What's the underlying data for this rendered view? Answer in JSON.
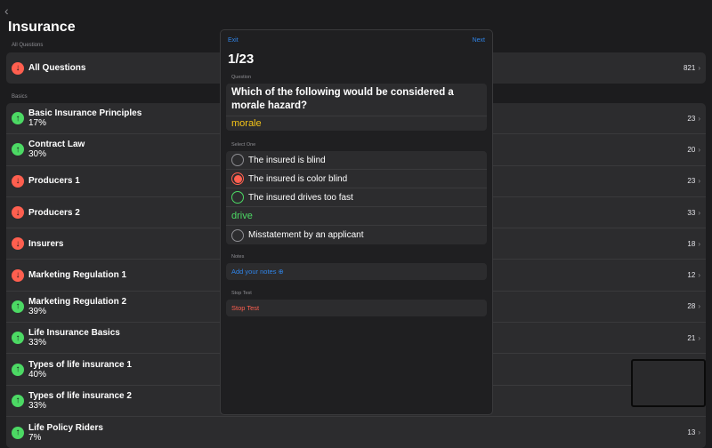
{
  "header": {
    "back_icon": "chevron-left-icon",
    "title": "Insurance"
  },
  "all_section": {
    "label": "All Questions",
    "item": {
      "name": "All Questions",
      "count": "821",
      "trend": "down"
    }
  },
  "basics": {
    "label": "Basics",
    "items": [
      {
        "name": "Basic Insurance Principles",
        "pct": "17%",
        "count": "23",
        "trend": "up"
      },
      {
        "name": "Contract Law",
        "pct": "30%",
        "count": "20",
        "trend": "up"
      },
      {
        "name": "Producers 1",
        "pct": "",
        "count": "23",
        "trend": "down"
      },
      {
        "name": "Producers 2",
        "pct": "",
        "count": "33",
        "trend": "down"
      },
      {
        "name": "Insurers",
        "pct": "",
        "count": "18",
        "trend": "down"
      },
      {
        "name": "Marketing Regulation 1",
        "pct": "",
        "count": "12",
        "trend": "down"
      },
      {
        "name": "Marketing Regulation 2",
        "pct": "39%",
        "count": "28",
        "trend": "up"
      },
      {
        "name": "Life Insurance Basics",
        "pct": "33%",
        "count": "21",
        "trend": "up"
      },
      {
        "name": "Types of life insurance 1",
        "pct": "40%",
        "count": "",
        "trend": "up"
      },
      {
        "name": "Types of life insurance 2",
        "pct": "33%",
        "count": "",
        "trend": "up"
      },
      {
        "name": "Life Policy Riders",
        "pct": "7%",
        "count": "13",
        "trend": "up"
      }
    ]
  },
  "quiz": {
    "exit": "Exit",
    "next": "Next",
    "progress": "1/23",
    "question_label": "Question",
    "question": "Which of the following would be considered a morale hazard?",
    "keyword": "morale",
    "select_label": "Select One",
    "options": [
      {
        "text": "The insured is blind",
        "state": "none"
      },
      {
        "text": "The insured is color blind",
        "state": "wrong"
      },
      {
        "text": "The insured drives too fast",
        "state": "correct"
      },
      {
        "text": "Misstatement by an applicant",
        "state": "none"
      }
    ],
    "answer_keyword": "drive",
    "notes_label": "Notes",
    "notes_button": "Add your notes",
    "stop_label": "Stop Test",
    "stop_button": "Stop Test"
  },
  "colors": {
    "accent": "#2f84e8",
    "up": "#4cd964",
    "down": "#ff5f4f",
    "keyword": "#f5c518"
  }
}
